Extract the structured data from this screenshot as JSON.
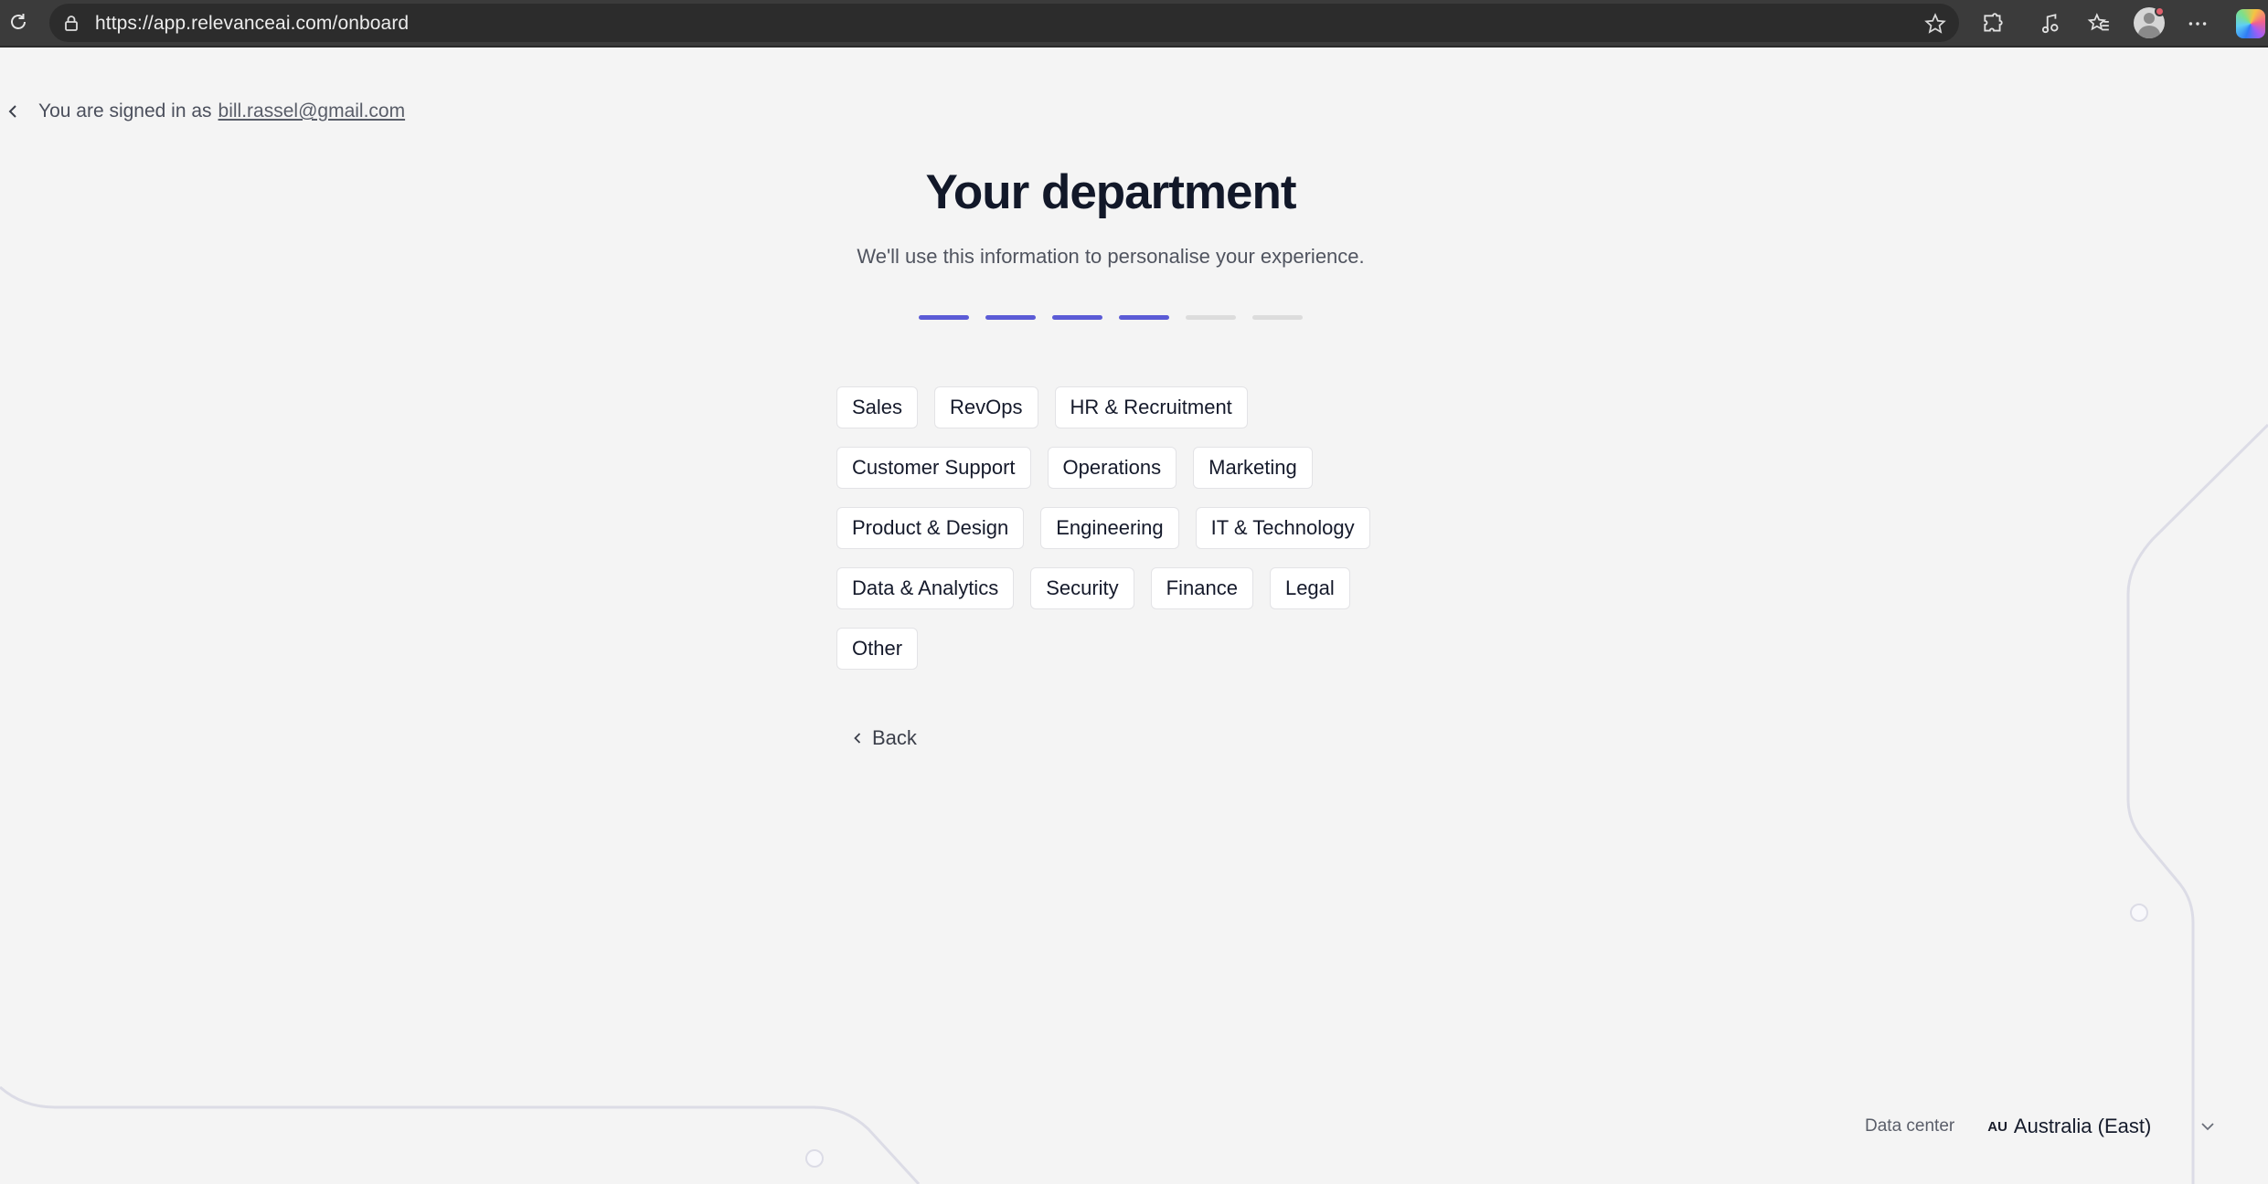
{
  "browser": {
    "url": "https://app.relevanceai.com/onboard",
    "icons": [
      "reload-icon",
      "lock-icon",
      "favorite-star-icon",
      "extensions-icon",
      "media-icon",
      "favorites-icon",
      "profile-avatar",
      "more-icon",
      "copilot-icon"
    ]
  },
  "signin": {
    "prefix": "You are signed in as",
    "email": "bill.rassel@gmail.com"
  },
  "onboard": {
    "title": "Your department",
    "subtitle": "We'll use this information to personalise your experience.",
    "progress": {
      "total_steps": 6,
      "completed_steps": 4,
      "accent_color": "#5b5bd6"
    },
    "departments": [
      [
        "Sales",
        "RevOps",
        "HR & Recruitment"
      ],
      [
        "Customer Support",
        "Operations",
        "Marketing"
      ],
      [
        "Product & Design",
        "Engineering",
        "IT & Technology"
      ],
      [
        "Data & Analytics",
        "Security",
        "Finance",
        "Legal"
      ],
      [
        "Other"
      ]
    ],
    "back_label": "Back"
  },
  "data_center": {
    "label": "Data center",
    "code": "AU",
    "value": "Australia (East)"
  }
}
